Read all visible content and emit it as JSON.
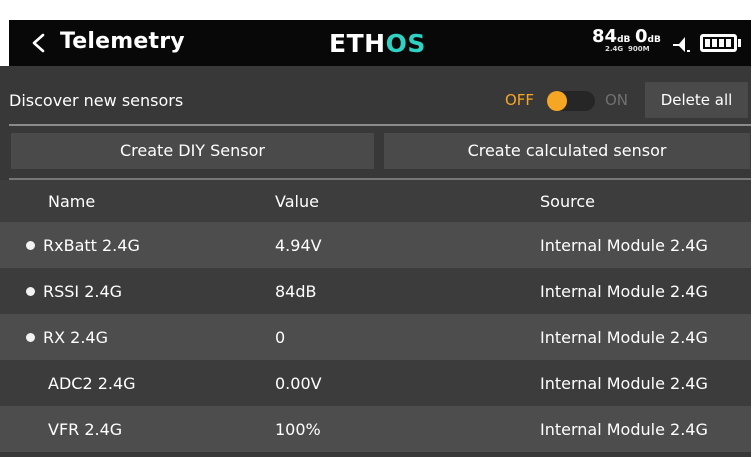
{
  "header": {
    "title": "Telemetry",
    "logo_part1": "ETH",
    "logo_part2": "OS",
    "rssi_24": "84",
    "rssi_24_unit": "dB",
    "rssi_900": "0",
    "rssi_900_unit": "dB",
    "band_24": "2.4G",
    "band_900": "900M"
  },
  "discover": {
    "label": "Discover new sensors",
    "off_label": "OFF",
    "on_label": "ON",
    "state": "off",
    "delete_all_label": "Delete all"
  },
  "actions": {
    "create_diy_label": "Create DIY Sensor",
    "create_calculated_label": "Create calculated sensor"
  },
  "table": {
    "columns": [
      "Name",
      "Value",
      "Source"
    ],
    "rows": [
      {
        "name": "RxBatt 2.4G",
        "value": "4.94V",
        "source": "Internal Module 2.4G",
        "active": true
      },
      {
        "name": "RSSI 2.4G",
        "value": "84dB",
        "source": "Internal Module 2.4G",
        "active": true
      },
      {
        "name": "RX 2.4G",
        "value": "0",
        "source": "Internal Module 2.4G",
        "active": true
      },
      {
        "name": "ADC2 2.4G",
        "value": "0.00V",
        "source": "Internal Module 2.4G",
        "active": false
      },
      {
        "name": "VFR 2.4G",
        "value": "100%",
        "source": "Internal Module 2.4G",
        "active": false
      }
    ]
  },
  "colors": {
    "accent_orange": "#f5a623",
    "logo_teal": "#2ed1c2",
    "header_bg": "#080808",
    "panel_bg": "#383838"
  },
  "icons": {
    "back": "chevron-left-icon",
    "signal": "signal-strength-icon",
    "battery": "battery-icon"
  }
}
